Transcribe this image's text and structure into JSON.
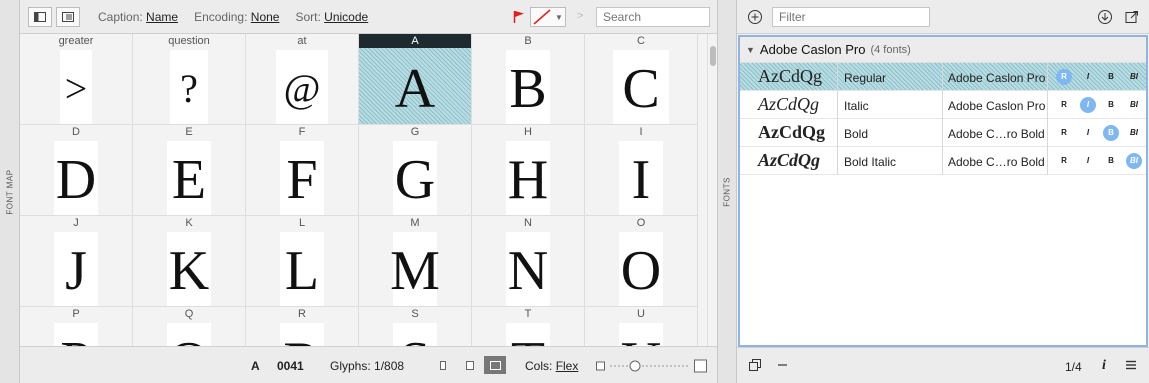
{
  "fontmap": {
    "panel_label": "FONT MAP",
    "toolbar": {
      "caption_label": "Caption:",
      "caption_value": "Name",
      "encoding_label": "Encoding:",
      "encoding_value": "None",
      "sort_label": "Sort:",
      "sort_value": "Unicode",
      "breadcrumb_sep": ">",
      "search_placeholder": "Search"
    },
    "rows": [
      [
        {
          "caption": "greater",
          "glyph": ">"
        },
        {
          "caption": "question",
          "glyph": "?"
        },
        {
          "caption": "at",
          "glyph": "@"
        },
        {
          "caption": "A",
          "glyph": "A"
        },
        {
          "caption": "B",
          "glyph": "B"
        },
        {
          "caption": "C",
          "glyph": "C"
        }
      ],
      [
        {
          "caption": "D",
          "glyph": "D"
        },
        {
          "caption": "E",
          "glyph": "E"
        },
        {
          "caption": "F",
          "glyph": "F"
        },
        {
          "caption": "G",
          "glyph": "G"
        },
        {
          "caption": "H",
          "glyph": "H"
        },
        {
          "caption": "I",
          "glyph": "I"
        }
      ],
      [
        {
          "caption": "J",
          "glyph": "J"
        },
        {
          "caption": "K",
          "glyph": "K"
        },
        {
          "caption": "L",
          "glyph": "L"
        },
        {
          "caption": "M",
          "glyph": "M"
        },
        {
          "caption": "N",
          "glyph": "N"
        },
        {
          "caption": "O",
          "glyph": "O"
        }
      ],
      [
        {
          "caption": "P",
          "glyph": "P"
        },
        {
          "caption": "Q",
          "glyph": "Q"
        },
        {
          "caption": "R",
          "glyph": "R"
        },
        {
          "caption": "S",
          "glyph": "S"
        },
        {
          "caption": "T",
          "glyph": "T"
        },
        {
          "caption": "U",
          "glyph": "U"
        }
      ]
    ],
    "status": {
      "char": "A",
      "code": "0041",
      "glyphs": "Glyphs: 1/808",
      "cols_label": "Cols:",
      "cols_value": "Flex"
    }
  },
  "fonts": {
    "panel_label": "FONTS",
    "filter_placeholder": "Filter",
    "family": {
      "name": "Adobe Caslon Pro",
      "count": "(4 fonts)"
    },
    "rows": [
      {
        "sample": "AzCdQg",
        "style": "Regular",
        "full_name": "Adobe Caslon Pro",
        "sel": true,
        "b_r": "R",
        "b_i": "I",
        "b_b": "B",
        "b_bi": "BI"
      },
      {
        "sample": "AzCdQg",
        "style": "Italic",
        "full_name": "Adobe Caslon Pro",
        "sel": false,
        "b_r": "R",
        "b_i": "I",
        "b_b": "B",
        "b_bi": "BI"
      },
      {
        "sample": "AzCdQg",
        "style": "Bold",
        "full_name": "Adobe C…ro Bold",
        "sel": false,
        "b_r": "R",
        "b_i": "I",
        "b_b": "B",
        "b_bi": "BI"
      },
      {
        "sample": "AzCdQg",
        "style": "Bold Italic",
        "full_name": "Adobe C…ro Bold",
        "sel": false,
        "b_r": "R",
        "b_i": "I",
        "b_b": "B",
        "b_bi": "BI"
      }
    ],
    "status": {
      "page": "1/4",
      "info": "i"
    }
  },
  "colors": {
    "selection": "#8cc2cc",
    "accent": "#7fb7f0",
    "flag": "#e02020"
  }
}
